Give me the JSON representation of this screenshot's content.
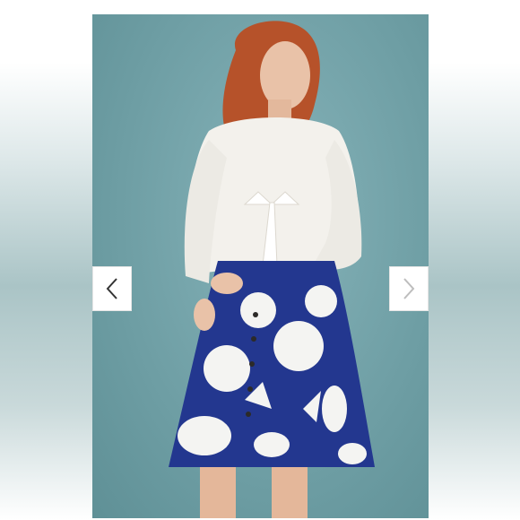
{
  "gallery": {
    "image_description_icon": "product-photo",
    "prev_icon": "chevron-left-icon",
    "next_icon": "chevron-right-icon",
    "colors": {
      "backdrop": "#6e9ea4",
      "skirt_blue": "#23378f",
      "skirt_white": "#f4f4f2",
      "blouse": "#f3f1ec",
      "hair": "#b6522a",
      "skin": "#e9c2a8",
      "prev_arrow": "#333333",
      "next_arrow": "#bdbdbd"
    }
  }
}
